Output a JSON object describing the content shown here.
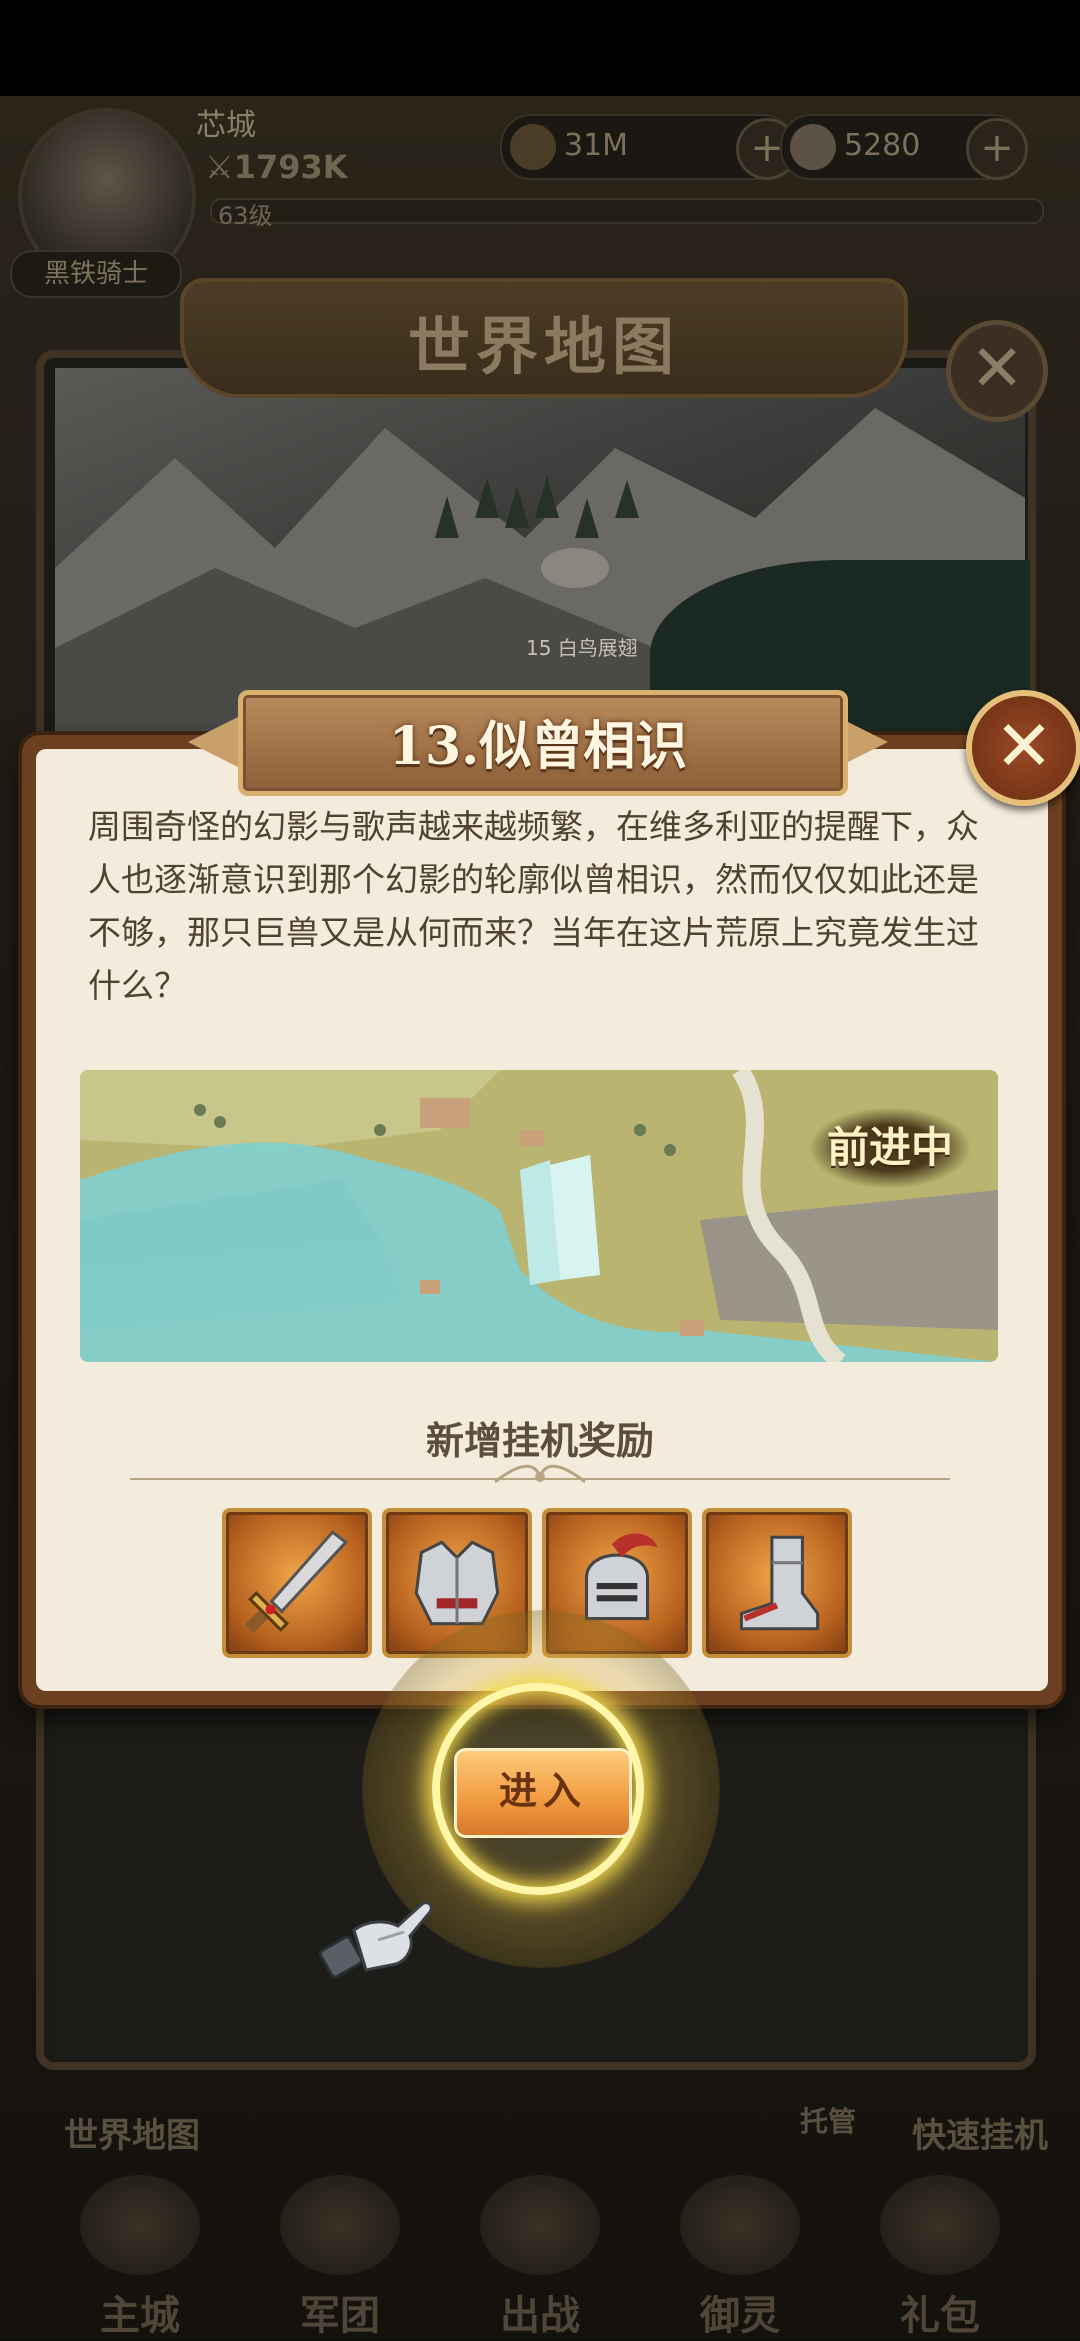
{
  "hud": {
    "player_name": "芯城",
    "power": "1793K",
    "level": "63级",
    "title": "黑铁骑士",
    "gold": "31M",
    "gems": "5280",
    "plus": "+"
  },
  "world_map": {
    "title": "世界地图",
    "node_label": "15 白鸟展翅",
    "close": "✕"
  },
  "stage_modal": {
    "title": "13.似曾相识",
    "close": "✕",
    "description": "周围奇怪的幻影与歌声越来越频繁，在维多利亚的提醒下，众人也逐渐意识到那个幻影的轮廓似曾相识，然而仅仅如此还是不够，那只巨兽又是从何而来？当年在这片荒原上究竟发生过什么？",
    "status": "前进中",
    "reward_title": "新增挂机奖励",
    "rewards": [
      {
        "icon": "sword-icon"
      },
      {
        "icon": "chest-armor-icon"
      },
      {
        "icon": "helmet-icon"
      },
      {
        "icon": "boots-icon"
      }
    ],
    "enter_button": "进入"
  },
  "bottom_bar": {
    "world_map_label": "世界地图",
    "auto_label": "托管",
    "quick_idle_label": "快速挂机",
    "tabs": [
      "主城",
      "军团",
      "出战",
      "御灵",
      "礼包"
    ]
  },
  "colors": {
    "modal_frame": "#6b3f1f",
    "modal_bg": "#f3ebdc",
    "ribbon": "#a87a4c",
    "reward_bg": "#e08a33",
    "button": "#f09a3f",
    "highlight": "#fff6a8"
  }
}
